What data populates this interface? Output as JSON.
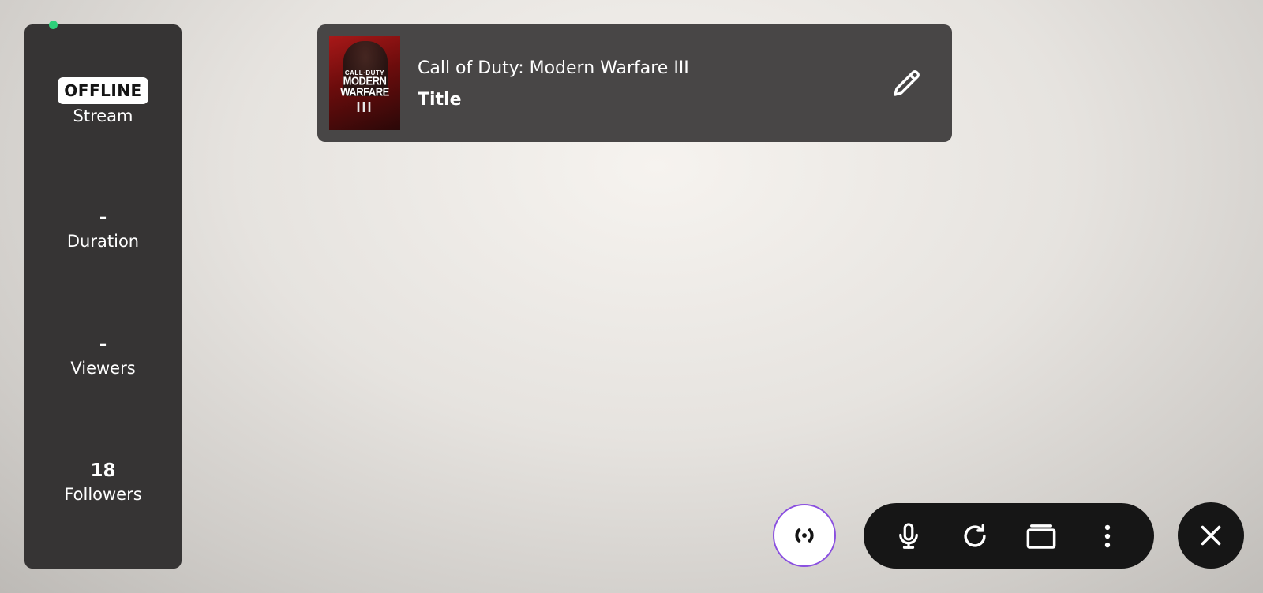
{
  "stats": {
    "stream": {
      "status": "OFFLINE",
      "label": "Stream"
    },
    "duration": {
      "value": "-",
      "label": "Duration"
    },
    "viewers": {
      "value": "-",
      "label": "Viewers"
    },
    "followers": {
      "value": "18",
      "label": "Followers"
    }
  },
  "game": {
    "name": "Call of Duty: Modern Warfare III",
    "stream_title": "Title",
    "cover": {
      "brand": "CALL·DUTY",
      "title_line1": "MODERN",
      "title_line2": "WARFARE",
      "numeral": "III"
    }
  },
  "icons": {
    "status_dot": "status-dot",
    "edit": "pencil-icon",
    "broadcast": "broadcast-icon",
    "mic": "microphone-icon",
    "refresh": "refresh-icon",
    "window": "window-icon",
    "more": "more-vertical-icon",
    "close": "close-icon"
  },
  "colors": {
    "status_online_dot": "#2fd07a",
    "panel_bg": "#363434",
    "card_bg": "#484646",
    "controls_bg": "#161616",
    "broadcast_ring": "#8a4fe0"
  }
}
